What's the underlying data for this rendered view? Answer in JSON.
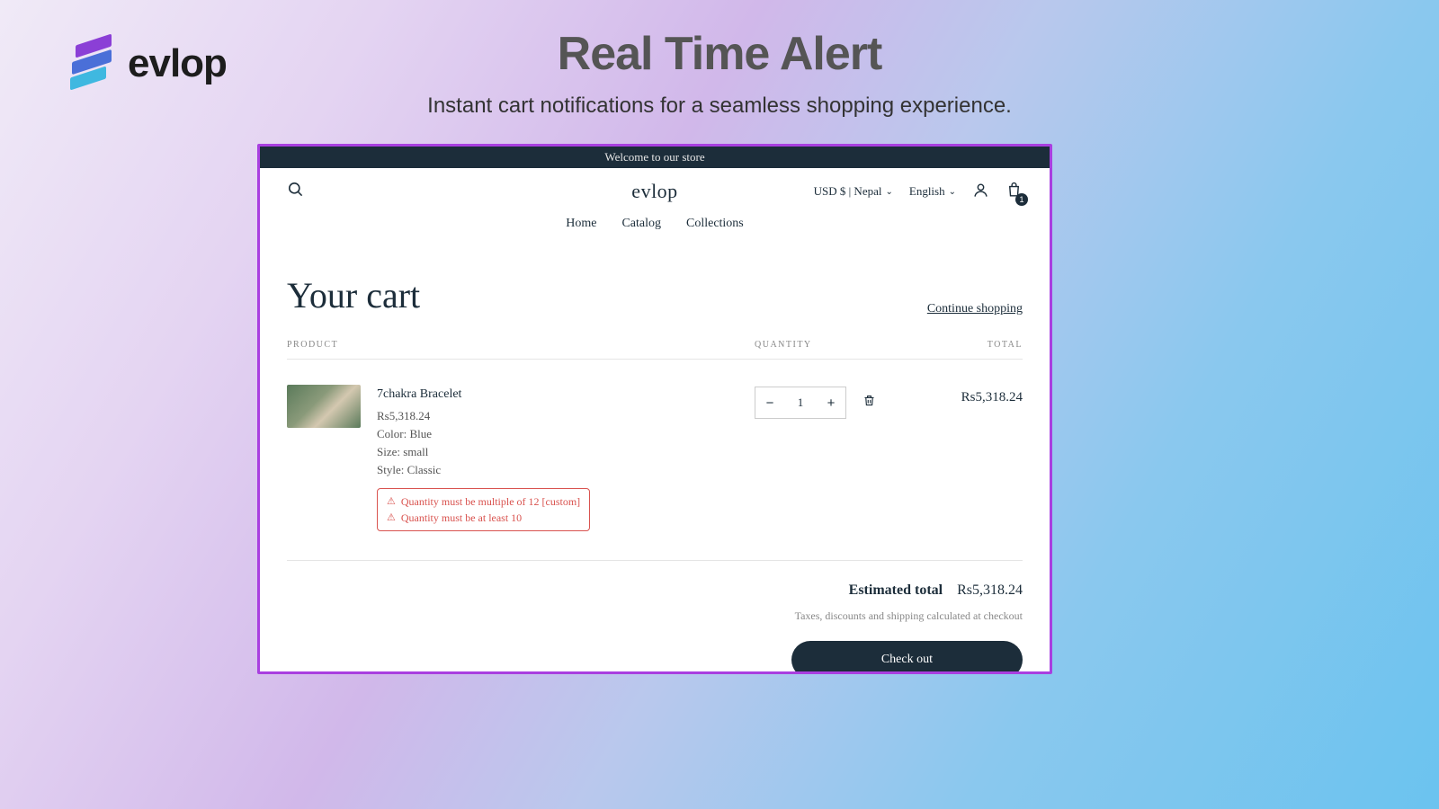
{
  "brand": {
    "logo_text": "evlop"
  },
  "hero": {
    "title": "Real Time Alert",
    "subtitle": "Instant cart notifications for a seamless shopping experience."
  },
  "store": {
    "announcement": "Welcome to our store",
    "name": "evlop",
    "currency_region": "USD $ | Nepal",
    "language": "English",
    "cart_count": "1",
    "nav": {
      "home": "Home",
      "catalog": "Catalog",
      "collections": "Collections"
    }
  },
  "cart": {
    "title": "Your cart",
    "continue_label": "Continue shopping",
    "columns": {
      "product": "PRODUCT",
      "quantity": "QUANTITY",
      "total": "TOTAL"
    },
    "item": {
      "name": "7chakra Bracelet",
      "price": "Rs5,318.24",
      "option_color": "Color: Blue",
      "option_size": "Size: small",
      "option_style": "Style: Classic",
      "alert1": "Quantity must be multiple of 12 [custom]",
      "alert2": "Quantity must be at least 10",
      "quantity": "1",
      "line_total": "Rs5,318.24"
    },
    "estimated_label": "Estimated total",
    "estimated_value": "Rs5,318.24",
    "tax_note": "Taxes, discounts and shipping calculated at checkout",
    "checkout_label": "Check out"
  }
}
